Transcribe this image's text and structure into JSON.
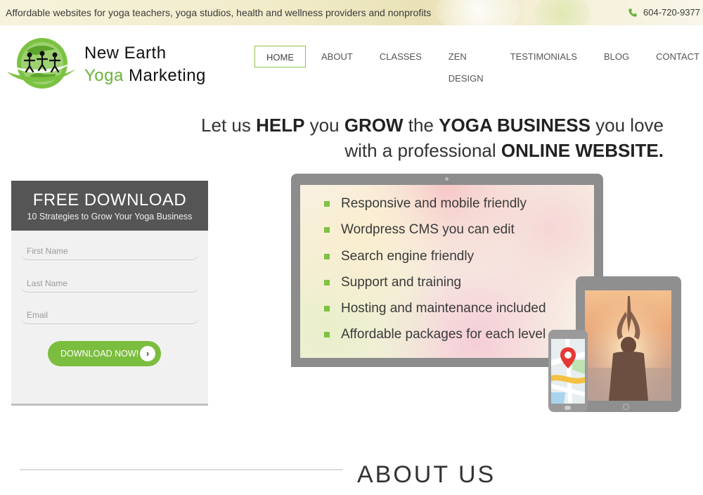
{
  "topbar": {
    "tagline": "Affordable websites for yoga teachers, yoga studios, health and wellness providers and nonprofits",
    "phone": "604-720-9377",
    "phone_icon": "phone-icon"
  },
  "logo": {
    "line1": "New Earth",
    "line2_green": "Yoga",
    "line2_rest": " Marketing",
    "icon": "globe-people-icon"
  },
  "nav": {
    "items": [
      "HOME",
      "ABOUT",
      "CLASSES",
      "ZEN DESIGN",
      "TESTIMONIALS",
      "BLOG",
      "CONTACT"
    ],
    "active": "HOME"
  },
  "headline": {
    "l1_a": "Let us ",
    "l1_b": "HELP",
    "l1_c": " you ",
    "l1_d": "GROW",
    "l1_e": " the ",
    "l1_f": "YOGA BUSINESS",
    "l1_g": " you love",
    "l2_a": "with a professional ",
    "l2_b": "ONLINE WEBSITE."
  },
  "form": {
    "title": "FREE DOWNLOAD",
    "subtitle": "10 Strategies to Grow Your Yoga Business",
    "first_name_placeholder": "First Name",
    "last_name_placeholder": "Last Name",
    "email_placeholder": "Email",
    "button_label": "DOWNLOAD NOW!",
    "button_icon": "chevron-right-icon"
  },
  "features": [
    "Responsive and mobile friendly",
    "Wordpress CMS you can edit",
    "Search engine friendly",
    "Support and training",
    "Hosting and maintenance included",
    "Affordable packages for each level"
  ],
  "about": {
    "title": "ABOUT US"
  },
  "colors": {
    "accent_green": "#7bbd3e",
    "form_header": "#555555",
    "device_gray": "#8c8c8c"
  }
}
